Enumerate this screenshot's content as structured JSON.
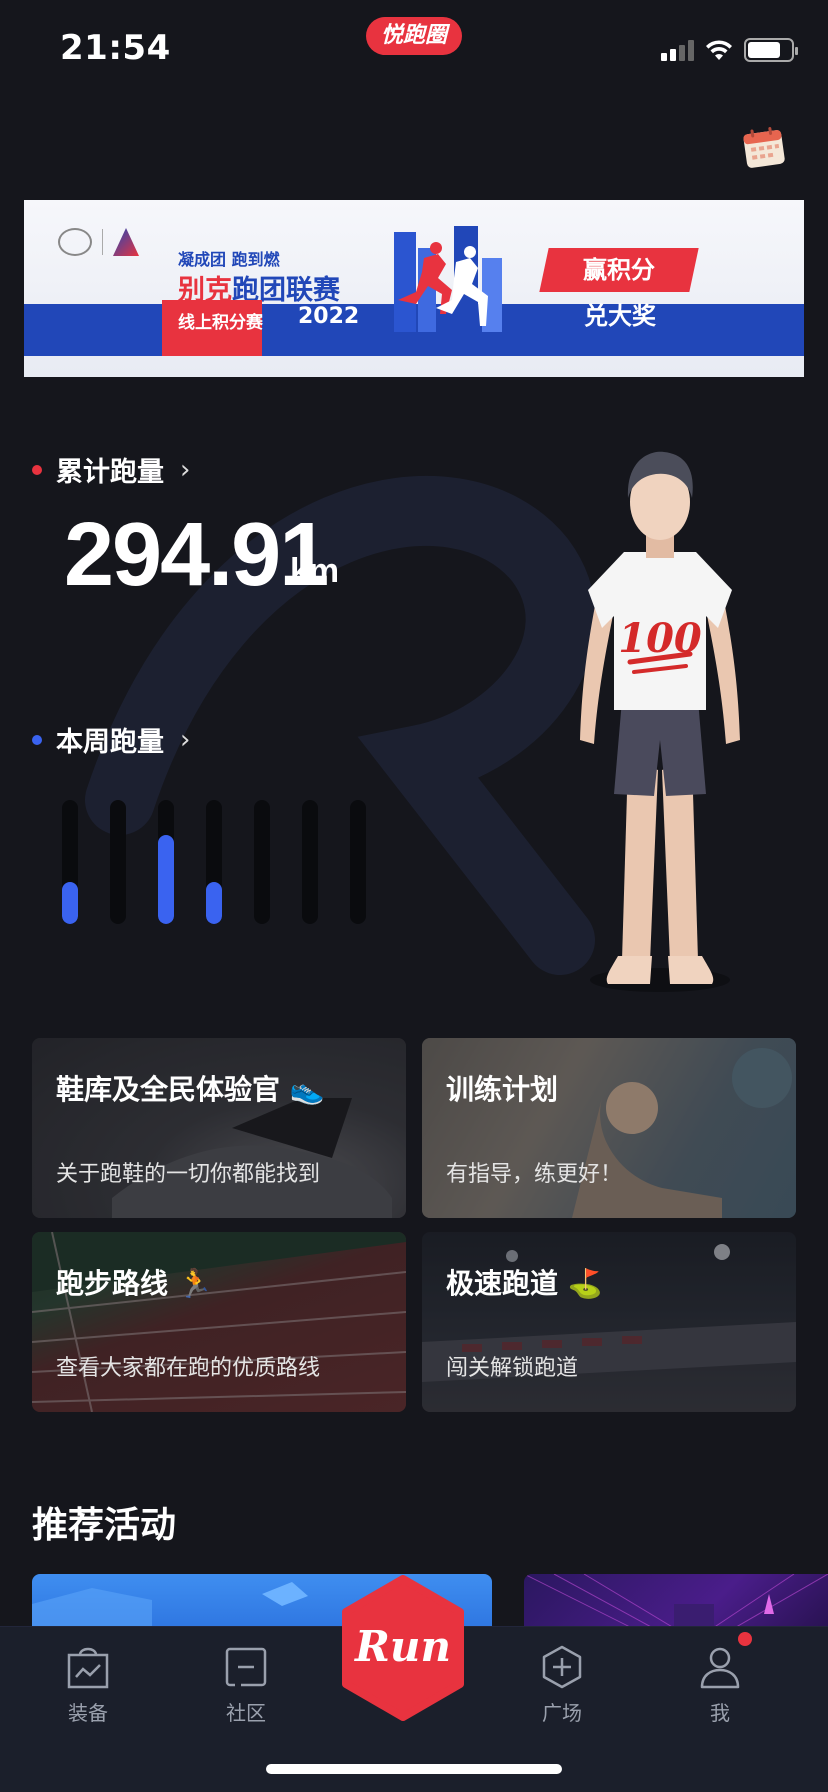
{
  "status_bar": {
    "time": "21:54",
    "app_pill": "悦跑圈",
    "battery_level": 0.75
  },
  "banner": {
    "slogan": "凝成团 跑到燃",
    "title_red": "别克",
    "title_blue": "跑团联赛",
    "subtitle": "线上积分赛",
    "year": "2022",
    "cta_top": "赢积分",
    "cta_bottom": "兑大奖",
    "colors": {
      "blue": "#2147b8",
      "red": "#e8333f"
    }
  },
  "total_distance": {
    "label": "累计跑量",
    "value": "294.91",
    "unit": "km",
    "dot_color": "#e8333f"
  },
  "weekly_distance": {
    "label": "本周跑量",
    "dot_color": "#3a63f0",
    "bar_levels": [
      0.34,
      0,
      0.72,
      0.34,
      0,
      0,
      0
    ]
  },
  "cards": [
    {
      "title": "鞋库及全民体验官",
      "icon": "sneaker-emoji",
      "subtitle": "关于跑鞋的一切你都能找到"
    },
    {
      "title": "训练计划",
      "icon": "",
      "subtitle": "有指导，练更好！"
    },
    {
      "title": "跑步路线",
      "icon": "runner-emoji",
      "subtitle": "查看大家都在跑的优质路线"
    },
    {
      "title": "极速跑道",
      "icon": "golf-flag-emoji",
      "subtitle": "闯关解锁跑道"
    }
  ],
  "recommended": {
    "title": "推荐活动"
  },
  "tabbar": {
    "equip": "装备",
    "community": "社区",
    "run": "Run",
    "square": "广场",
    "me": "我",
    "accent": "#e8333f"
  }
}
